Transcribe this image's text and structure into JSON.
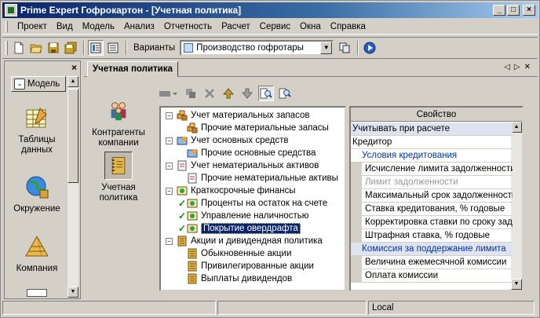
{
  "window": {
    "title": "Prime Expert Гофрокартон - [Учетная политика]",
    "controls": [
      "minimize",
      "maximize",
      "close"
    ]
  },
  "menu": [
    "Проект",
    "Вид",
    "Модель",
    "Анализ",
    "Отчетность",
    "Расчет",
    "Сервис",
    "Окна",
    "Справка"
  ],
  "toolbar": {
    "variants_label": "Варианты",
    "variant_value": "Производство гофротары"
  },
  "left_pane": {
    "model_button": "Модель",
    "items": [
      {
        "label": "Таблицы данных",
        "icon": "table-icon"
      },
      {
        "label": "Окружение",
        "icon": "globe-icon"
      },
      {
        "label": "Компания",
        "icon": "pyramid-icon"
      }
    ]
  },
  "doc_tab": {
    "label": "Учетная политика"
  },
  "inner_nav": [
    {
      "label": "Контрагенты компании",
      "icon": "people-icon"
    },
    {
      "label": "Учетная политика",
      "icon": "notebook-icon",
      "selected": true
    }
  ],
  "tree": [
    {
      "label": "Учет материальных запасов",
      "level": 0,
      "expander": "−",
      "icon": "materials-icon"
    },
    {
      "label": "Прочие материальные запасы",
      "level": 1,
      "icon": "materials-icon"
    },
    {
      "label": "Учет основных средств",
      "level": 0,
      "expander": "−",
      "icon": "assets-icon"
    },
    {
      "label": "Прочие основные средства",
      "level": 1,
      "icon": "assets-icon"
    },
    {
      "label": "Учет нематериальных активов",
      "level": 0,
      "expander": "−",
      "icon": "intangible-icon"
    },
    {
      "label": "Прочие нематериальные активы",
      "level": 1,
      "icon": "intangible-icon"
    },
    {
      "label": "Краткосрочные финансы",
      "level": 0,
      "expander": "−",
      "icon": "finance-icon"
    },
    {
      "label": "Проценты на остаток на счете",
      "level": 1,
      "icon": "finance-icon",
      "checked": true
    },
    {
      "label": "Управление наличностью",
      "level": 1,
      "icon": "finance-icon",
      "checked": true
    },
    {
      "label": "Покрытие овердрафта",
      "level": 1,
      "icon": "finance-icon",
      "checked": true,
      "selected": true
    },
    {
      "label": "Акции и дивидендная политика",
      "level": 0,
      "expander": "−",
      "icon": "shares-icon"
    },
    {
      "label": "Обыкновенные акции",
      "level": 1,
      "icon": "shares-icon"
    },
    {
      "label": "Привилегированные акции",
      "level": 1,
      "icon": "shares-icon"
    },
    {
      "label": "Выплаты дивидендов",
      "level": 1,
      "icon": "shares-icon"
    }
  ],
  "props": {
    "header": "Свойство",
    "rows": [
      {
        "label": "Учитывать при расчете",
        "kind": "hl"
      },
      {
        "label": "Кредитор",
        "kind": "plain"
      },
      {
        "label": "Условия кредитования",
        "kind": "cat"
      },
      {
        "label": "Исчисление лимита задолженности",
        "kind": "sub"
      },
      {
        "label": "Лимит задолженности",
        "kind": "dis"
      },
      {
        "label": "Максимальный срок задолженности, дн",
        "kind": "sub"
      },
      {
        "label": "Ставка кредитования, % годовые",
        "kind": "sub"
      },
      {
        "label": "Корректировка ставки по сроку задолж",
        "kind": "sub"
      },
      {
        "label": "Штрафная ставка, % годовые",
        "kind": "sub"
      },
      {
        "label": "Комиссия за поддержание лимита",
        "kind": "cat-hl"
      },
      {
        "label": "Величина ежемесячной комиссии",
        "kind": "sub"
      },
      {
        "label": "Оплата комиссии",
        "kind": "sub"
      }
    ]
  },
  "status": {
    "cell1": "",
    "cell2": "",
    "cell3": "Local"
  }
}
